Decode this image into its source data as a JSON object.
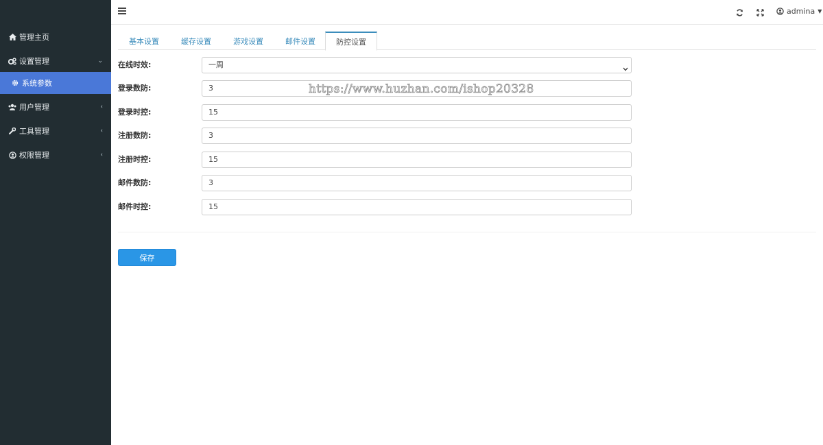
{
  "sidebar": {
    "items": [
      {
        "label": "管理主页",
        "icon": "home-icon"
      },
      {
        "label": "设置管理",
        "icon": "cogs-icon",
        "arrow": "⌄"
      },
      {
        "label": "系统参数",
        "icon": "gear-icon"
      },
      {
        "label": "用户管理",
        "icon": "users-icon",
        "arrow": "‹"
      },
      {
        "label": "工具管理",
        "icon": "wrench-icon",
        "arrow": "‹"
      },
      {
        "label": "权限管理",
        "icon": "user-circle-icon",
        "arrow": "‹"
      }
    ]
  },
  "topbar": {
    "user_name": "admina"
  },
  "tabs": [
    {
      "label": "基本设置"
    },
    {
      "label": "缓存设置"
    },
    {
      "label": "游戏设置"
    },
    {
      "label": "邮件设置"
    },
    {
      "label": "防控设置",
      "active": true
    }
  ],
  "form": {
    "online_timeout": {
      "label": "在线时效:",
      "value": "一周"
    },
    "login_count": {
      "label": "登录数防:",
      "value": "3"
    },
    "login_time": {
      "label": "登录时控:",
      "value": "15"
    },
    "register_count": {
      "label": "注册数防:",
      "value": "3"
    },
    "register_time": {
      "label": "注册时控:",
      "value": "15"
    },
    "mail_count": {
      "label": "邮件数防:",
      "value": "3"
    },
    "mail_time": {
      "label": "邮件时控:",
      "value": "15"
    }
  },
  "save_label": "保存",
  "watermark": "https://www.huzhan.com/ishop20328",
  "colors": {
    "sidebar_bg": "#222d32",
    "sidebar_active": "#4a78d8",
    "tab_link": "#3c8dbc",
    "save_button": "#2a96e6"
  }
}
